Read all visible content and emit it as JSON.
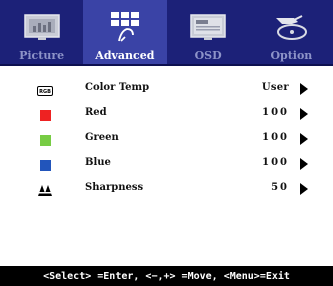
{
  "tabs": [
    {
      "label": "Picture",
      "icon": "picture-icon",
      "active": false
    },
    {
      "label": "Advanced",
      "icon": "advanced-icon",
      "active": true
    },
    {
      "label": "OSD",
      "icon": "osd-icon",
      "active": false
    },
    {
      "label": "Option",
      "icon": "option-icon",
      "active": false
    }
  ],
  "rows": [
    {
      "icon": "rgb-icon",
      "icon_text": "RGB",
      "label": "Color Temp",
      "value": "User"
    },
    {
      "icon": "red-square-icon",
      "color": "#ee2222",
      "label": "Red",
      "value": "100"
    },
    {
      "icon": "green-square-icon",
      "color": "#77cc44",
      "label": "Green",
      "value": "100"
    },
    {
      "icon": "blue-square-icon",
      "color": "#2255bb",
      "label": "Blue",
      "value": "100"
    },
    {
      "icon": "sharpness-icon",
      "label": "Sharpness",
      "value": "50"
    }
  ],
  "footer": "<Select> =Enter, <−,+> =Move, <Menu>=Exit",
  "colors": {
    "tabbar": "#1c2178",
    "active_tab": "#3a43a6",
    "footer_bg": "#000000"
  }
}
